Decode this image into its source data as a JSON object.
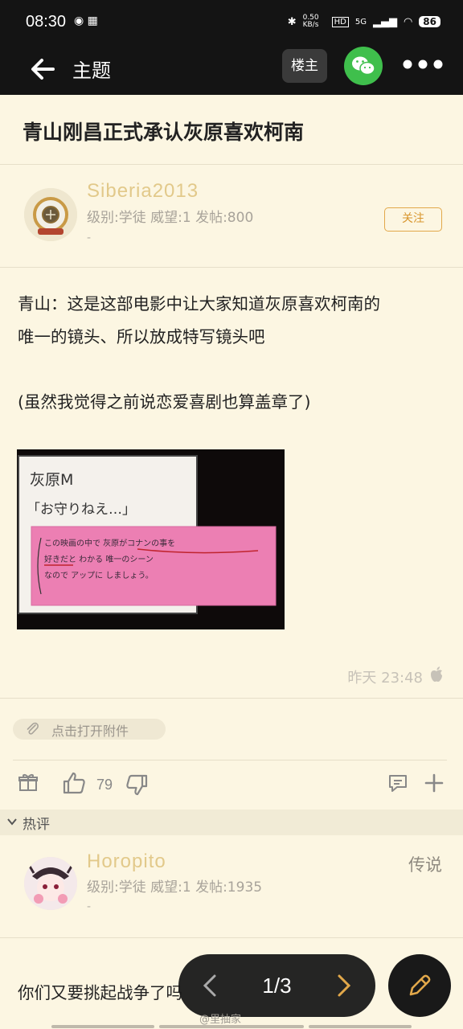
{
  "status_bar": {
    "time": "08:30",
    "network_speed": "0.50 KB/s",
    "hd": "HD",
    "signal": "5G",
    "battery": "86"
  },
  "header": {
    "title": "主题",
    "op_button": "楼主"
  },
  "thread": {
    "title": "青山刚昌正式承认灰原喜欢柯南"
  },
  "post": {
    "author": "Siberia2013",
    "meta": "级别:学徒 威望:1 发帖:800",
    "signature": "-",
    "follow_label": "关注",
    "body_line1": "青山：这是这部电影中让大家知道灰原喜欢柯南的",
    "body_line2": "唯一的镜头、所以放成特写镜头吧",
    "body_line3": "(虽然我觉得之前说恋爱喜剧也算盖章了)",
    "image": {
      "line1": "灰原M",
      "line2": "「お守りねえ…」",
      "note1": "この映画の中で 灰原がコナンの事を",
      "note2": "好きだと わかる 唯一のシーン",
      "note3": "なので アップに しましょう。"
    },
    "timestamp": "昨天 23:48",
    "attachment": "点击打开附件",
    "likes": "79"
  },
  "hot_section": {
    "label": "热评"
  },
  "reply": {
    "author": "Horopito",
    "rank": "传说",
    "meta": "级别:学徒 威望:1 发帖:1935",
    "signature": "-",
    "text": "你们又要挑起战争了吗"
  },
  "pager": {
    "page": "1/3"
  },
  "watermark": "@里抽家",
  "colors": {
    "username": "#e2c98a",
    "follow": "#e2a84a",
    "wechat": "#3fbf4c",
    "background": "#fcf6e2"
  }
}
